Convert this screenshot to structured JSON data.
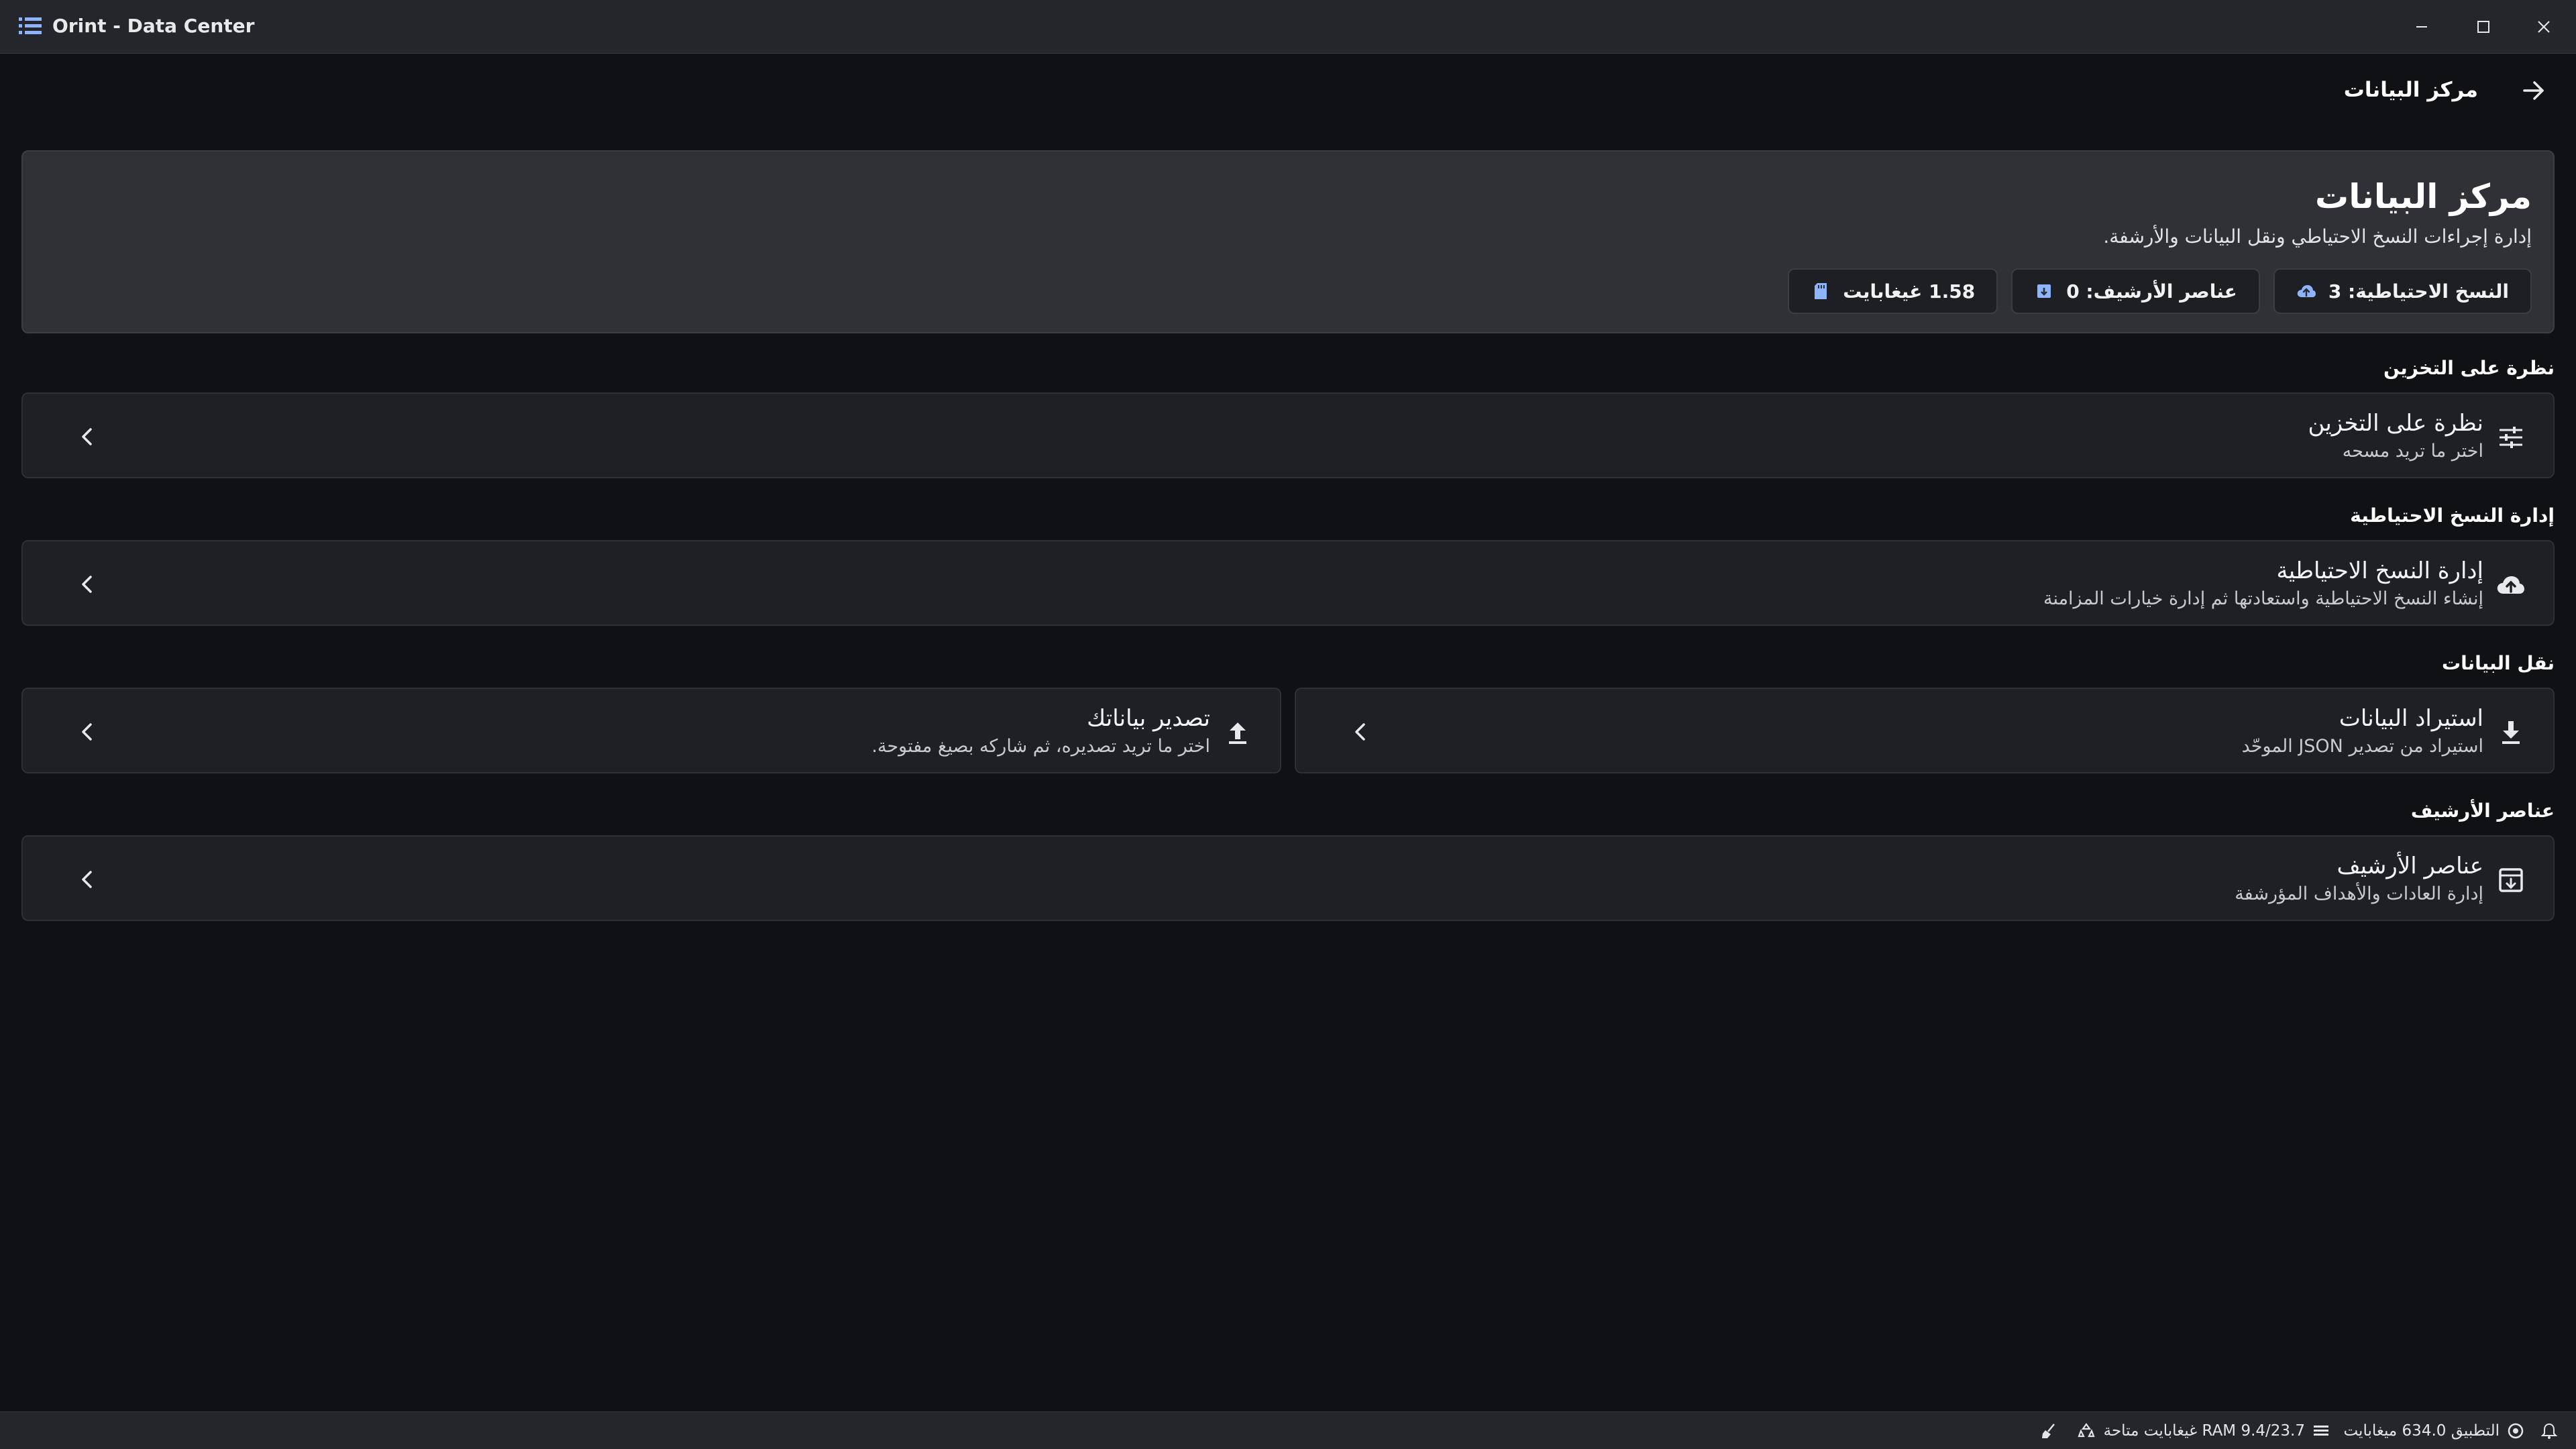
{
  "window": {
    "title": "Orint - Data Center",
    "icon": "list-icon"
  },
  "header": {
    "title": "مركز البيانات",
    "back_icon": "arrow-right-icon"
  },
  "hero": {
    "title": "مركز البيانات",
    "subtitle": "إدارة إجراءات النسخ الاحتياطي ونقل البيانات والأرشفة.",
    "chips": [
      {
        "label": "النسخ الاحتياطية: 3",
        "icon": "cloud-upload-icon"
      },
      {
        "label": "عناصر الأرشيف: 0",
        "icon": "archive-icon"
      },
      {
        "label": "1.58 غيغابايت",
        "icon": "sd-card-icon"
      }
    ]
  },
  "sections": {
    "storage": {
      "label": "نظرة على التخزين",
      "card_title": "نظرة على التخزين",
      "card_sub": "اختر ما تريد مسحه",
      "icon": "sliders-icon"
    },
    "backup": {
      "label": "إدارة النسخ الاحتياطية",
      "card_title": "إدارة النسخ الاحتياطية",
      "card_sub": "إنشاء النسخ الاحتياطية واستعادتها ثم إدارة خيارات المزامنة",
      "icon": "cloud-upload-icon"
    },
    "transfer": {
      "label": "نقل البيانات",
      "import_title": "استيراد البيانات",
      "import_sub": "استيراد من تصدير JSON الموحّد",
      "import_icon": "download-icon",
      "export_title": "تصدير بياناتك",
      "export_sub": "اختر ما تريد تصديره، ثم شاركه بصيغ مفتوحة.",
      "export_icon": "upload-icon"
    },
    "archive": {
      "label": "عناصر الأرشيف",
      "card_title": "عناصر الأرشيف",
      "card_sub": "إدارة العادات والأهداف المؤرشفة",
      "icon": "archive-box-icon"
    }
  },
  "statusbar": {
    "app_usage": "التطبيق 634.0 ميغابايت",
    "ram": "RAM 9.4/23.7 غيغابايت متاحة"
  },
  "colors": {
    "background": "#0f1115",
    "titlebar": "#24262b",
    "hero": "#2f3136",
    "card": "#1e2025",
    "chip_icon": "#8fb4ff"
  }
}
